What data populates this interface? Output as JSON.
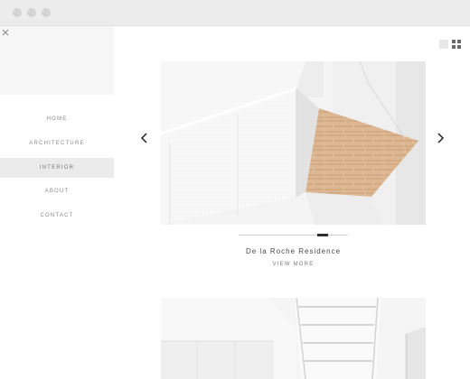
{
  "window": {
    "controls": [
      "close",
      "minimize",
      "maximize"
    ]
  },
  "sidebar": {
    "close_icon": "close-icon",
    "items": [
      {
        "label": "HOME",
        "active": false
      },
      {
        "label": "ARCHITECTURE",
        "active": false
      },
      {
        "label": "INTERIOR",
        "active": true
      },
      {
        "label": "ABOUT",
        "active": false
      },
      {
        "label": "CONTACT",
        "active": false
      }
    ]
  },
  "view_toggle": {
    "single_icon": "single-view-icon",
    "grid_icon": "grid-view-icon",
    "selected": "grid"
  },
  "carousel": {
    "left_icon": "chevron-left-icon",
    "right_icon": "chevron-right-icon",
    "active_slide_fraction": 0.78
  },
  "project": {
    "title": "De la Roche Residence",
    "link_label": "VIEW MORE"
  },
  "colors": {
    "background": "#ffffff",
    "titlebar": "#ececec",
    "sidebar_active": "#ebebeb",
    "wood": "#d7b08b",
    "text_dark": "#4a4a4a",
    "text_light": "#8a8a8a"
  }
}
